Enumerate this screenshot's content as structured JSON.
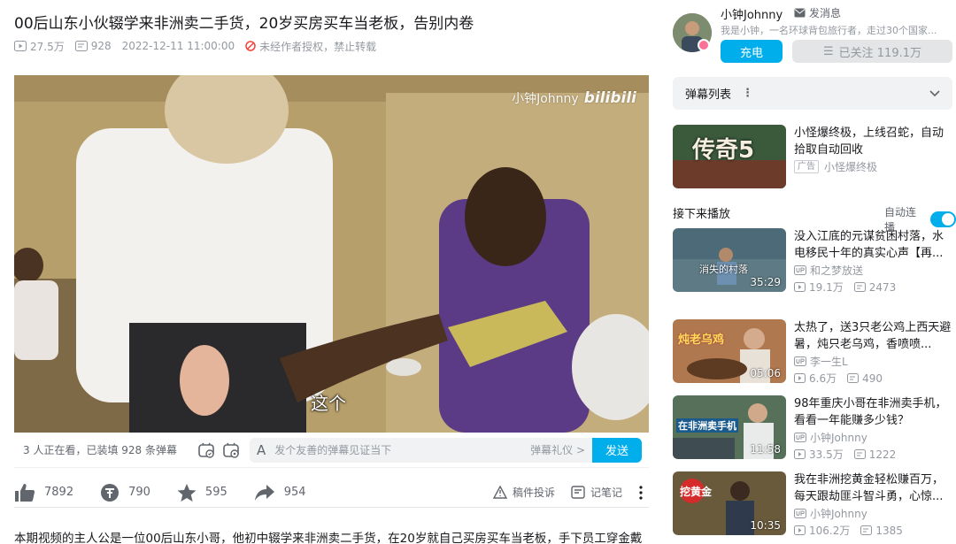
{
  "video": {
    "title": "00后山东小伙辍学来非洲卖二手货，20岁买房买车当老板，告别内卷",
    "views": "27.5万",
    "danmaku_count": "928",
    "date": "2022-12-11 11:00:00",
    "copyright": "未经作者授权，禁止转载",
    "watermark_name": "小钟Johnny",
    "watermark_logo": "bilibili",
    "subtitle": "这个"
  },
  "danmaku_bar": {
    "viewers": "3 人正在看，已装填 928 条弹幕",
    "font_icon": "A",
    "placeholder": "发个友善的弹幕见证当下",
    "etiquette": "弹幕礼仪 >",
    "send": "发送"
  },
  "actions": {
    "like": "7892",
    "coin": "790",
    "favorite": "595",
    "share": "954",
    "report": "稿件投诉",
    "notes": "记笔记"
  },
  "description": "本期视频的主人公是一位00后山东小哥，他初中辍学来非洲卖二手货，在20岁就自己买房买车当老板，手下员工穿金戴",
  "uploader": {
    "name": "小钟Johnny",
    "message": "发消息",
    "sign": "我是小钟，一名环球背包旅行者，走过30个国家...",
    "charge": "充电",
    "follow": "已关注 119.1万",
    "follow_icon": "☰"
  },
  "danmaku_list": {
    "label": "弹幕列表",
    "dots": "⋮"
  },
  "ad": {
    "title": "小怪爆终极，上线召蛇，自动拾取自动回收",
    "tag": "广告",
    "author": "小怪爆终极",
    "thumb_text": "传奇5"
  },
  "next": {
    "label": "接下来播放",
    "autoplay": "自动连播"
  },
  "recommend": [
    {
      "title": "没入江底的元谋贫困村落，水电移民十年的真实心声【再...",
      "author": "和之梦放送",
      "views": "19.1万",
      "danmaku": "2473",
      "duration": "35:29",
      "thumb_text": "消失的村落"
    },
    {
      "title": "太热了，送3只老公鸡上西天避暑，炖只老乌鸡，香喷喷...",
      "author": "李一生L",
      "views": "6.6万",
      "danmaku": "490",
      "duration": "05:06",
      "thumb_text": "炖老乌鸡"
    },
    {
      "title": "98年重庆小哥在非洲卖手机，看看一年能赚多少钱？",
      "author": "小钟Johnny",
      "views": "33.5万",
      "danmaku": "1222",
      "duration": "11:58",
      "thumb_text": "在非洲卖手机"
    },
    {
      "title": "我在非洲挖黄金轻松赚百万，每天跟劫匪斗智斗勇，心惊...",
      "author": "小钟Johnny",
      "views": "106.2万",
      "danmaku": "1385",
      "duration": "10:35",
      "thumb_text": "挖黄金"
    }
  ],
  "colors": {
    "accent": "#00aeec",
    "text": "#18191c",
    "muted": "#9499a0",
    "pink": "#fb7299"
  }
}
